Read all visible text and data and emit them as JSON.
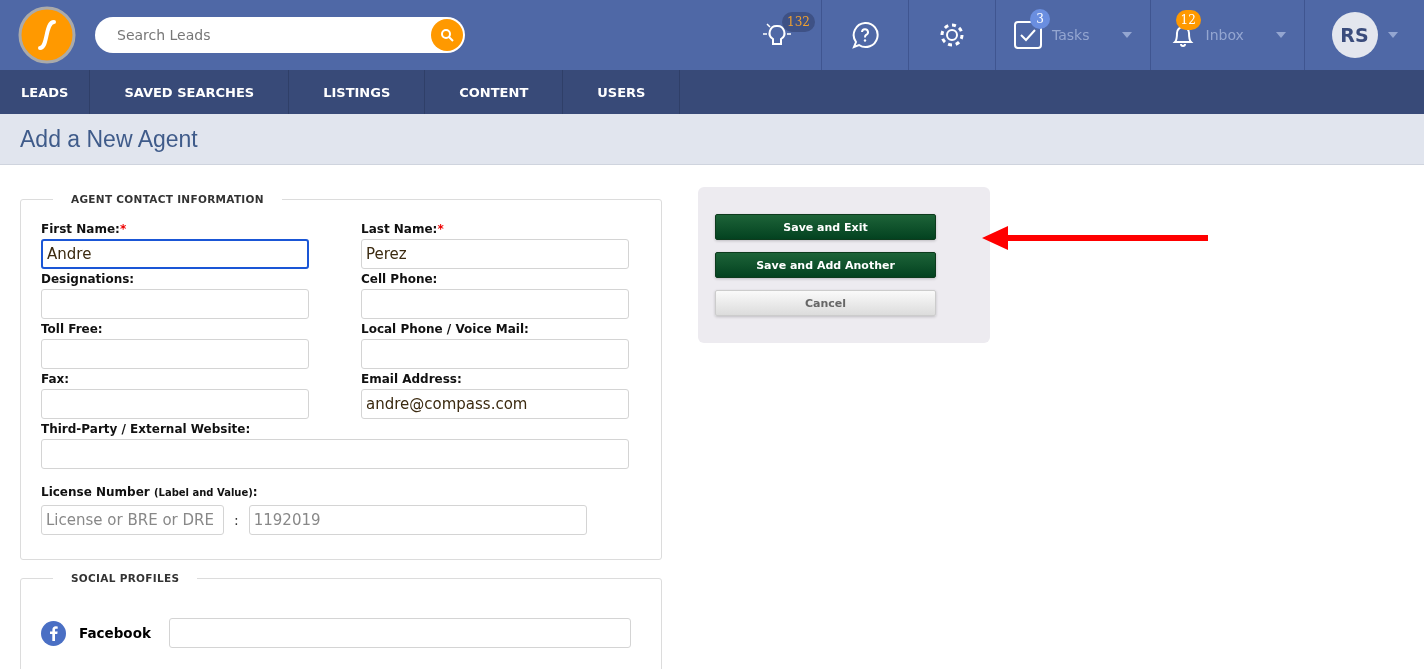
{
  "header": {
    "search": {
      "placeholder": "Search Leads"
    },
    "ideas": {
      "badge": "132"
    },
    "tasks": {
      "label": "Tasks",
      "badge": "3"
    },
    "inbox": {
      "label": "Inbox",
      "badge": "12"
    },
    "avatar": {
      "initials": "RS"
    }
  },
  "nav": [
    {
      "label": "LEADS"
    },
    {
      "label": "SAVED SEARCHES"
    },
    {
      "label": "LISTINGS"
    },
    {
      "label": "CONTENT"
    },
    {
      "label": "USERS"
    }
  ],
  "page_title": "Add a New Agent",
  "contact_section": {
    "title": "AGENT CONTACT INFORMATION",
    "fields": [
      {
        "kind": "half",
        "label": "First Name:",
        "required_mark": "*",
        "value": "Andre",
        "focused": true
      },
      {
        "kind": "half",
        "label": "Last Name:",
        "required_mark": "*",
        "value": "Perez",
        "focused": false
      },
      {
        "kind": "half",
        "label": "Designations:",
        "focused": false
      },
      {
        "kind": "half",
        "label": "Cell Phone:",
        "focused": false
      },
      {
        "kind": "half",
        "label": "Toll Free:",
        "focused": false
      },
      {
        "kind": "half",
        "label": "Local Phone / Voice Mail:",
        "focused": false
      },
      {
        "kind": "half",
        "label": "Fax:",
        "focused": false
      },
      {
        "kind": "half",
        "label": "Email Address:",
        "value": "andre@compass.com",
        "focused": false
      },
      {
        "kind": "full",
        "label": "Third-Party / External Website:",
        "focused": false
      }
    ],
    "license": {
      "label": "License Number **(Label and Value)**:",
      "label_placeholder": "License or BRE or DRE",
      "separator": ":",
      "value_placeholder": "1192019"
    }
  },
  "social_section": {
    "title": "SOCIAL PROFILES",
    "profiles": [
      {
        "label": "Facebook"
      }
    ]
  },
  "actions": [
    {
      "label": "Save and Exit",
      "kind": "primary"
    },
    {
      "label": "Save and Add Another",
      "kind": "primary"
    },
    {
      "label": "Cancel",
      "kind": "secondary"
    }
  ]
}
